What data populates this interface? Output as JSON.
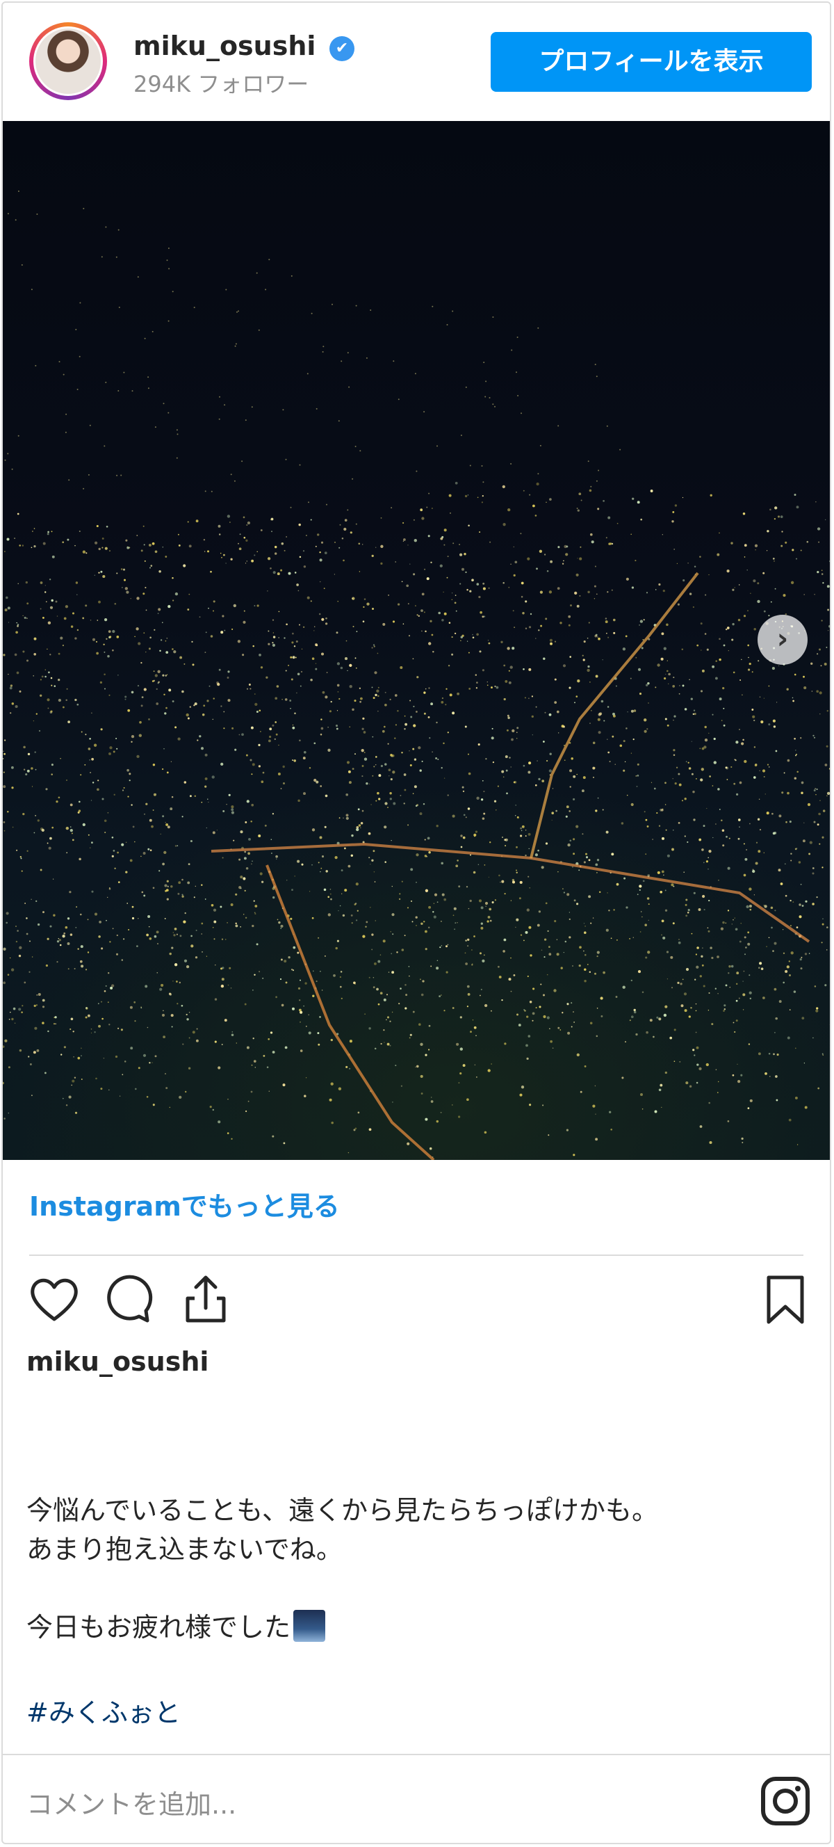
{
  "header": {
    "username": "miku_osushi",
    "verified_glyph": "✔",
    "followers": "294K フォロワー",
    "profile_button": "プロフィールを表示"
  },
  "post": {
    "image_icon": "city-night-aerial-photo",
    "next_glyph": "›",
    "more_link": "Instagramでもっと見る"
  },
  "actions": {
    "like_icon": "heart-icon",
    "comment_icon": "comment-icon",
    "share_icon": "share-icon",
    "save_icon": "bookmark-icon"
  },
  "caption": {
    "username": "miku_osushi",
    "line1": "今悩んでいることも、遠くから見たらちっぽけかも。",
    "line2": "あまり抱え込まないでね。",
    "line3": "今日もお疲れ様でした",
    "line3_emoji": "night-city-emoji",
    "hashtag": "#みくふぉと"
  },
  "footer": {
    "comment_placeholder": "コメントを追加...",
    "logo_icon": "instagram-icon"
  },
  "colors": {
    "accent": "#0095f6",
    "link": "#1c8ce0",
    "hashtag": "#00376b",
    "muted": "#8e8e8e"
  }
}
